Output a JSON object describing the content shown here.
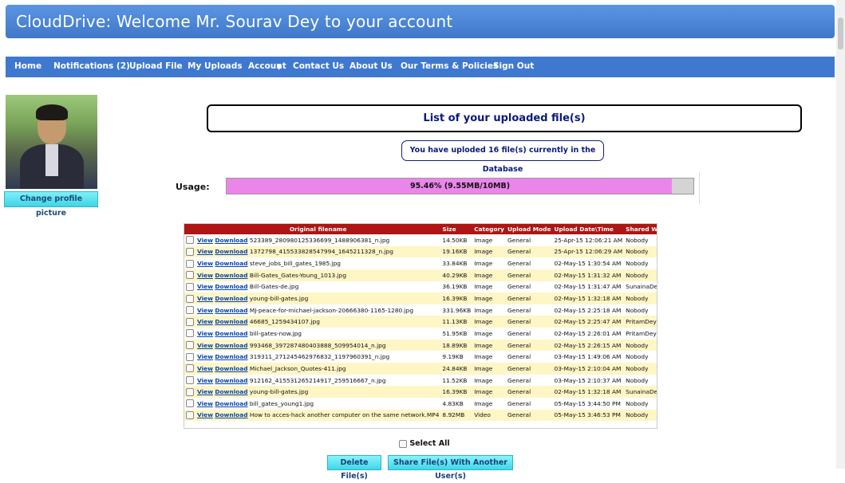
{
  "header": {
    "title": "CloudDrive: Welcome Mr. Sourav Dey to your account"
  },
  "nav": [
    {
      "label": "Home"
    },
    {
      "label": "Notifications (2)"
    },
    {
      "label": "Upload File"
    },
    {
      "label": "My Uploads"
    },
    {
      "label": "Account"
    },
    {
      "label": "Contact Us"
    },
    {
      "label": "About Us"
    },
    {
      "label": "Our Terms & Policies"
    },
    {
      "label": "Sign Out"
    }
  ],
  "profile": {
    "change_label": "Change profile picture"
  },
  "list": {
    "title": "List of your uploaded file(s)",
    "count_text": "You have uploded 16 file(s) currently in the Database"
  },
  "usage": {
    "label": "Usage:",
    "text": "95.46% (9.55MB/10MB)",
    "percent": 95.46
  },
  "table": {
    "headers": [
      "Original filename",
      "Size",
      "Category",
      "Upload Mode",
      "Upload Date\\Time",
      "Shared With"
    ],
    "view_label": "View",
    "download_label": "Download",
    "rows": [
      [
        "523389_280980125336699_1488906381_n.jpg",
        "14.50KB",
        "Image",
        "General",
        "25-Apr-15 12:06:21 AM",
        "Nobody"
      ],
      [
        "1372798_415533828547994_1645211328_n.jpg",
        "19.16KB",
        "Image",
        "General",
        "25-Apr-15 12:06:29 AM",
        "Nobody"
      ],
      [
        "steve_jobs_bill_gates_1985.jpg",
        "33.84KB",
        "Image",
        "General",
        "02-May-15 1:30:54 AM",
        "Nobody"
      ],
      [
        "Bill-Gates_Gates-Young_1013.jpg",
        "40.29KB",
        "Image",
        "General",
        "02-May-15 1:31:32 AM",
        "Nobody"
      ],
      [
        "Bill-Gates-de.jpg",
        "36.19KB",
        "Image",
        "General",
        "02-May-15 1:31:47 AM",
        "SunainaDey"
      ],
      [
        "young-bill-gates.jpg",
        "16.39KB",
        "Image",
        "General",
        "02-May-15 1:32:18 AM",
        "Nobody"
      ],
      [
        "MJ-peace-for-michael-jackson-20666380-1165-1280.jpg",
        "331.96KB",
        "Image",
        "General",
        "02-May-15 2:25:18 AM",
        "Nobody"
      ],
      [
        "46685_1259434107.jpg",
        "11.13KB",
        "Image",
        "General",
        "02-May-15 2:25:47 AM",
        "PritamDey"
      ],
      [
        "bill-gates-now.jpg",
        "51.95KB",
        "Image",
        "General",
        "02-May-15 2:26:01 AM",
        "PritamDey"
      ],
      [
        "993468_397287480403888_509954014_n.jpg",
        "18.89KB",
        "Image",
        "General",
        "02-May-15 2:26:15 AM",
        "Nobody"
      ],
      [
        "319311_271245462976832_1197960391_n.jpg",
        "9.19KB",
        "Image",
        "General",
        "03-May-15 1:49:06 AM",
        "Nobody"
      ],
      [
        "Michael_Jackson_Quotes-411.jpg",
        "24.84KB",
        "Image",
        "General",
        "03-May-15 2:10:04 AM",
        "Nobody"
      ],
      [
        "912162_415531265214917_259516667_n.jpg",
        "11.52KB",
        "Image",
        "General",
        "03-May-15 2:10:37 AM",
        "Nobody"
      ],
      [
        "young-bill-gates.jpg",
        "16.39KB",
        "Image",
        "General",
        "02-May-15 1:32:18 AM",
        "SunainaDey"
      ],
      [
        "bill_gates_young1.jpg",
        "4.83KB",
        "Image",
        "General",
        "05-May-15 3:44:50 PM",
        "Nobody"
      ],
      [
        "How to acces-hack another computer on the same network.MP4",
        "8.92MB",
        "Video",
        "General",
        "05-May-15 3:46:53 PM",
        "Nobody"
      ]
    ]
  },
  "select_all": "Select All",
  "buttons": {
    "delete": "Delete File(s)",
    "share": "Share File(s) With Another User(s)"
  },
  "colors": {
    "header": "#4a86d8",
    "nav": "#3f79cf",
    "table_header": "#b01414",
    "row_alt": "#fff6c6",
    "usage_fill": "#ea86ea"
  }
}
